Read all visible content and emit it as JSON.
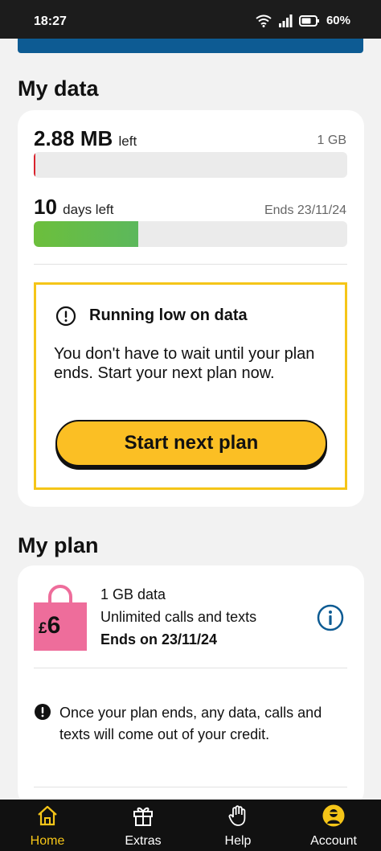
{
  "status_bar": {
    "time": "18:27",
    "battery": "60%"
  },
  "my_data": {
    "section_title": "My data",
    "amount": "2.88 MB",
    "amount_suffix": "left",
    "allowance": "1 GB",
    "data_remaining_fraction": 0.003,
    "days": "10",
    "days_suffix": "days left",
    "ends": "Ends 23/11/24",
    "days_remaining_fraction": 0.333
  },
  "low_data": {
    "title": "Running low on data",
    "text": "You don't have to wait until your plan ends. Start your next plan now.",
    "button": "Start next plan"
  },
  "my_plan": {
    "section_title": "My plan",
    "price_symbol": "£",
    "price_value": "6",
    "line1": "1 GB data",
    "line2": "Unlimited calls and texts",
    "line3": "Ends on 23/11/24",
    "info_text": "Once your plan ends, any data, calls and texts will come out of your credit."
  },
  "nav": [
    {
      "label": "Home"
    },
    {
      "label": "Extras"
    },
    {
      "label": "Help"
    },
    {
      "label": "Account"
    }
  ],
  "colors": {
    "accent_yellow": "#f5c518",
    "button_yellow": "#fbbf24",
    "progress_green": "#5cb85c",
    "data_red": "#d9232d",
    "plan_pink": "#ee6d9b",
    "brand_blue": "#0d5b93"
  }
}
